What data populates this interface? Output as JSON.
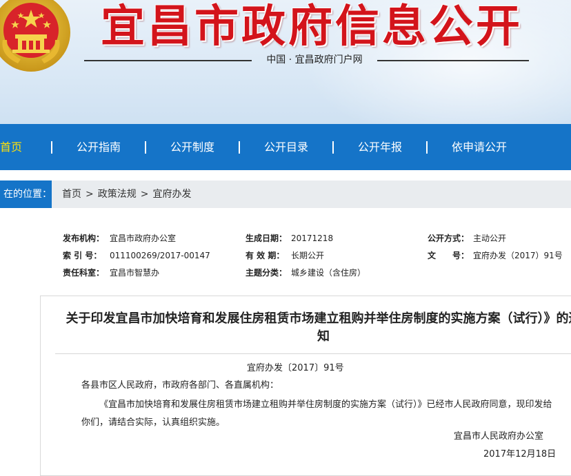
{
  "header": {
    "site_title": "宜昌市政府信息公开",
    "subtitle": "中国 · 宜昌政府门户网",
    "emblem_icon": "national-emblem-icon"
  },
  "nav": {
    "items": [
      {
        "label": "开首页",
        "active": true
      },
      {
        "label": "公开指南",
        "active": false
      },
      {
        "label": "公开制度",
        "active": false
      },
      {
        "label": "公开目录",
        "active": false
      },
      {
        "label": "公开年报",
        "active": false
      },
      {
        "label": "依申请公开",
        "active": false
      }
    ],
    "separator": "|"
  },
  "breadcrumb": {
    "label": "在的位置：",
    "items": [
      "首页",
      "政策法规",
      "宜府办发"
    ],
    "separator": ">"
  },
  "meta": {
    "publisher_label": "发布机构：",
    "publisher": "宜昌市政府办公室",
    "date_label": "生成日期：",
    "date": "20171218",
    "disclosure_label": "公开方式：",
    "disclosure": "主动公开",
    "index_label": "索 引 号：",
    "index": "011100269/2017-00147",
    "validity_label": "有 效 期：",
    "validity": "长期公开",
    "docno_label": "文　　号：",
    "docno": "宜府办发（2017）91号",
    "dept_label": "责任科室：",
    "dept": "宜昌市智慧办",
    "topic_label": "主题分类：",
    "topic": "城乡建设（含住房）"
  },
  "article": {
    "title": "关于印发宜昌市加快培育和发展住房租赁市场建立租购并举住房制度的实施方案（试行）》的通知",
    "doc_number": "宜府办发〔2017〕91号",
    "addressee": "各县市区人民政府，市政府各部门、各直属机构：",
    "body": "《宜昌市加快培育和发展住房租赁市场建立租购并举住房制度的实施方案（试行）》已经市人民政府同意，现印发给你们，请结合实际，认真组织实施。",
    "signature_org": "宜昌市人民政府办公室",
    "signature_date": "2017年12月18日"
  },
  "colors": {
    "brand_red": "#d3141b",
    "nav_blue": "#1574c8",
    "nav_active": "#ffe10a",
    "crumb_bg": "#e9ecef"
  }
}
